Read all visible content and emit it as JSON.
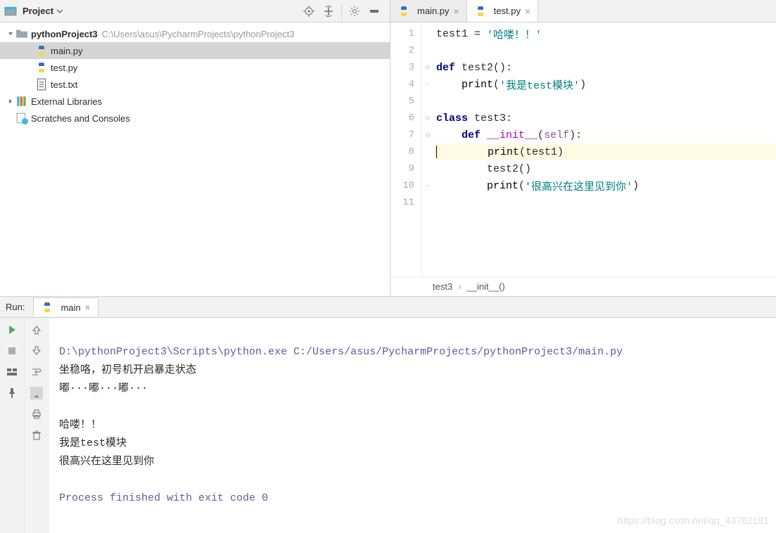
{
  "project_panel": {
    "title": "Project",
    "root": {
      "name": "pythonProject3",
      "path": "C:\\Users\\asus\\PycharmProjects\\pythonProject3"
    },
    "files": [
      {
        "name": "main.py",
        "type": "python"
      },
      {
        "name": "test.py",
        "type": "python"
      },
      {
        "name": "test.txt",
        "type": "text"
      }
    ],
    "external_libs": "External Libraries",
    "scratches": "Scratches and Consoles"
  },
  "editor": {
    "tabs": [
      {
        "label": "main.py",
        "active": false
      },
      {
        "label": "test.py",
        "active": true
      }
    ],
    "lines": [
      "1",
      "2",
      "3",
      "4",
      "5",
      "6",
      "7",
      "8",
      "9",
      "10",
      "11"
    ],
    "code": {
      "l1_a": "test1 = ",
      "l1_b": "'哈喽！！'",
      "l3_a": "def ",
      "l3_b": "test2():",
      "l4_a": "    ",
      "l4_b": "print",
      "l4_c": "(",
      "l4_d": "'我是test模块'",
      "l4_e": ")",
      "l6_a": "class ",
      "l6_b": "test3:",
      "l7_a": "    ",
      "l7_b": "def ",
      "l7_c": "__init__",
      "l7_d": "(",
      "l7_e": "self",
      "l7_f": "):",
      "l8_a": "        ",
      "l8_b": "print",
      "l8_c": "(test1)",
      "l9_a": "        test2()",
      "l10_a": "        ",
      "l10_b": "print",
      "l10_c": "(",
      "l10_d": "'很高兴在这里见到你'",
      "l10_e": ")"
    },
    "breadcrumb": {
      "cls": "test3",
      "fn": "__init__()"
    }
  },
  "run": {
    "label": "Run:",
    "tab": "main",
    "command": "D:\\pythonProject3\\Scripts\\python.exe C:/Users/asus/PycharmProjects/pythonProject3/main.py",
    "output": [
      "坐稳咯，初号机开启暴走状态",
      "嘟···嘟···嘟···",
      "",
      "哈喽！！",
      "我是test模块",
      "很高兴在这里见到你"
    ],
    "exit": "Process finished with exit code 0"
  },
  "watermark": "https://blog.csdn.net/qq_43762191"
}
